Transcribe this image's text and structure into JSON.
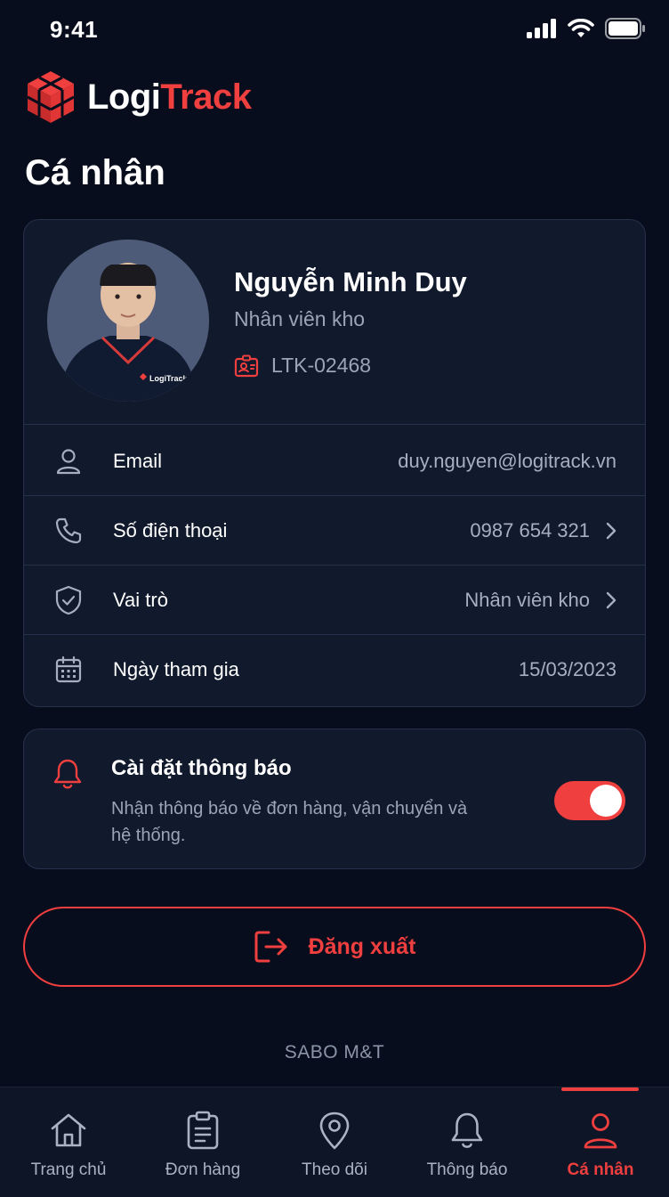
{
  "status_bar": {
    "time": "9:41"
  },
  "brand": {
    "name_part1": "Logi",
    "name_part2": "Track",
    "accent_color": "#ef3f3f"
  },
  "page": {
    "title": "Cá nhân"
  },
  "profile": {
    "name": "Nguyễn Minh Duy",
    "role": "Nhân viên kho",
    "employee_id": "LTK-02468",
    "avatar_shirt_logo": "LogiTrack"
  },
  "info_rows": [
    {
      "icon": "user-icon",
      "label": "Email",
      "value": "duy.nguyen@logitrack.vn",
      "has_chevron": false
    },
    {
      "icon": "phone-icon",
      "label": "Số điện thoại",
      "value": "0987 654 321",
      "has_chevron": true
    },
    {
      "icon": "shield-icon",
      "label": "Vai trò",
      "value": "Nhân viên kho",
      "has_chevron": true
    },
    {
      "icon": "calendar-icon",
      "label": "Ngày tham gia",
      "value": "15/03/2023",
      "has_chevron": false
    }
  ],
  "notification_settings": {
    "title": "Cài đặt thông báo",
    "description": "Nhận thông báo về đơn hàng, vận chuyển và hệ thống.",
    "enabled": true
  },
  "logout": {
    "label": "Đăng xuất"
  },
  "footer": {
    "text": "SABO M&T"
  },
  "bottom_nav": {
    "items": [
      {
        "label": "Trang chủ",
        "icon": "home-icon",
        "active": false
      },
      {
        "label": "Đơn hàng",
        "icon": "clipboard-icon",
        "active": false
      },
      {
        "label": "Theo dõi",
        "icon": "map-pin-icon",
        "active": false
      },
      {
        "label": "Thông báo",
        "icon": "bell-icon",
        "active": false
      },
      {
        "label": "Cá nhân",
        "icon": "user-icon",
        "active": true
      }
    ]
  }
}
